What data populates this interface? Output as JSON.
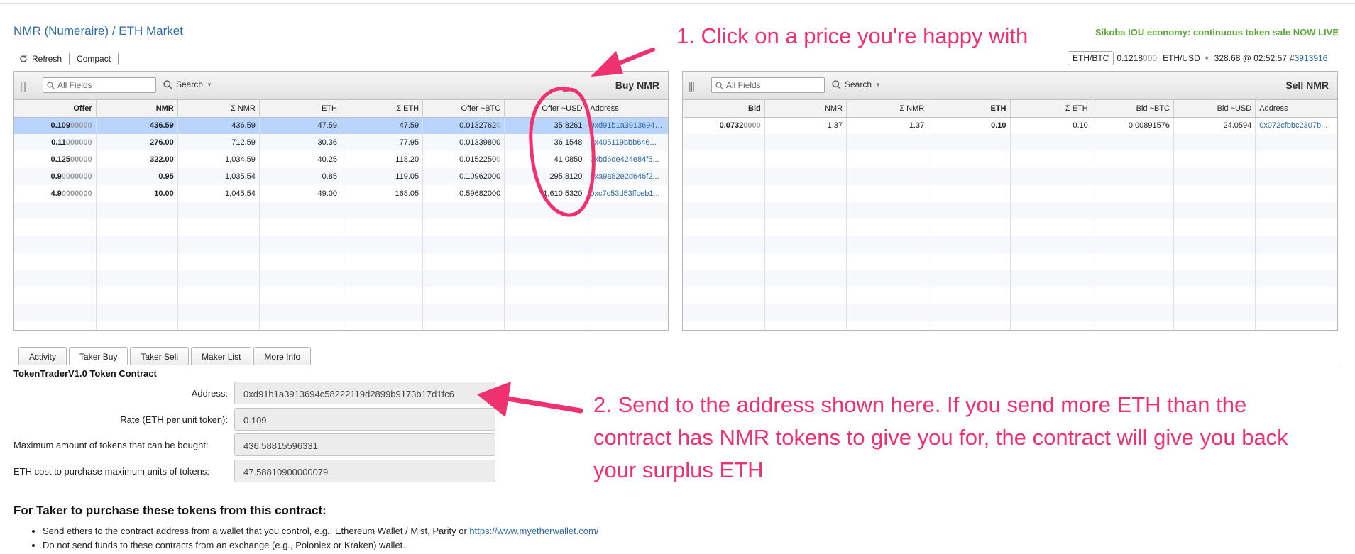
{
  "header": {
    "title": "NMR (Numeraire) / ETH Market",
    "promo": "Sikoba IOU economy: continuous token sale NOW LIVE"
  },
  "toolbar": {
    "refresh": "Refresh",
    "compact": "Compact"
  },
  "rates": {
    "selected_pair": "ETH/BTC",
    "eth_btc_main": "0.1218",
    "eth_btc_dim": "000",
    "eth_usd_label": "ETH/USD",
    "eth_usd_value": "328.68 @ 02:52:57",
    "block_hash": "#",
    "block_number": "3913916"
  },
  "buy_grid": {
    "title": "Buy NMR",
    "search_placeholder": "All Fields",
    "search_label": "Search",
    "columns": [
      "Offer",
      "NMR",
      "Σ NMR",
      "ETH",
      "Σ ETH",
      "Offer ~BTC",
      "Offer ~USD",
      "Address"
    ],
    "rows": [
      {
        "offer_main": "0.109",
        "offer_dim": "00000",
        "nmr": "436.59",
        "sum_nmr": "436.59",
        "eth": "47.59",
        "sum_eth": "47.59",
        "btc": "0.0132762",
        "btc_dim": "0",
        "usd": "35.8261",
        "address": "0xd91b1a3913694c58222119d2899b9173b17d1fc6"
      },
      {
        "offer_main": "0.11",
        "offer_dim": "000000",
        "nmr": "276.00",
        "sum_nmr": "712.59",
        "eth": "30.36",
        "sum_eth": "77.95",
        "btc": "0.01339800",
        "btc_dim": "",
        "usd": "36.1548",
        "address": "0x405119bbb646..."
      },
      {
        "offer_main": "0.125",
        "offer_dim": "00000",
        "nmr": "322.00",
        "sum_nmr": "1,034.59",
        "eth": "40.25",
        "sum_eth": "118.20",
        "btc": "0.0152250",
        "btc_dim": "0",
        "usd": "41.0850",
        "address": "0xbd6de424e84f5..."
      },
      {
        "offer_main": "0.9",
        "offer_dim": "0000000",
        "nmr": "0.95",
        "sum_nmr": "1,035.54",
        "eth": "0.85",
        "sum_eth": "119.05",
        "btc": "0.10962000",
        "btc_dim": "",
        "usd": "295.8120",
        "address": "0xa9a82e2d646f2..."
      },
      {
        "offer_main": "4.9",
        "offer_dim": "0000000",
        "nmr": "10.00",
        "sum_nmr": "1,045.54",
        "eth": "49.00",
        "sum_eth": "168.05",
        "btc": "0.59682000",
        "btc_dim": "",
        "usd": "1,610.5320",
        "address": "0xc7c53d53ffceb1..."
      }
    ]
  },
  "sell_grid": {
    "title": "Sell NMR",
    "search_placeholder": "All Fields",
    "search_label": "Search",
    "columns": [
      "Bid",
      "NMR",
      "Σ NMR",
      "ETH",
      "Σ ETH",
      "Bid ~BTC",
      "Bid ~USD",
      "Address"
    ],
    "rows": [
      {
        "bid_main": "0.0732",
        "bid_dim": "0000",
        "nmr": "1.37",
        "sum_nmr": "1.37",
        "eth": "0.10",
        "sum_eth": "0.10",
        "btc": "0.00891576",
        "usd": "24.0594",
        "address": "0x072cfbbc2307b..."
      }
    ]
  },
  "tabs": [
    "Activity",
    "Taker Buy",
    "Taker Sell",
    "Maker List",
    "More Info"
  ],
  "active_tab": "Taker Buy",
  "contract": {
    "title": "TokenTraderV1.0 Token Contract",
    "address_label": "Address:",
    "address": "0xd91b1a3913694c58222119d2899b9173b17d1fc6",
    "rate_label": "Rate (ETH per unit token):",
    "rate": "0.109",
    "max_tokens_label": "Maximum amount of tokens that can be bought:",
    "max_tokens": "436.58815596331",
    "eth_cost_label": "ETH cost to purchase maximum units of tokens:",
    "eth_cost": "47.58810900000079"
  },
  "instructions": {
    "title": "For Taker to purchase these tokens from this contract:",
    "bullet1_text": "Send ethers to the contract address from a wallet that you control, e.g., Ethereum Wallet / Mist, Parity or ",
    "bullet1_link": "https://www.myetherwallet.com/",
    "bullet2_text": "Do not send funds to these contracts from an exchange (e.g., Poloniex or Kraken) wallet."
  },
  "annotations": {
    "step1": "1. Click on a price you're happy with",
    "step2": "2. Send to the address shown here.  If you send more ETH than the contract has NMR tokens to give you for, the contract will give you back your surplus ETH"
  },
  "colors": {
    "annotation": "#f0316f",
    "link": "#2c6aa8",
    "promo": "#5fa73c",
    "selected_row": "#bad5fd"
  }
}
